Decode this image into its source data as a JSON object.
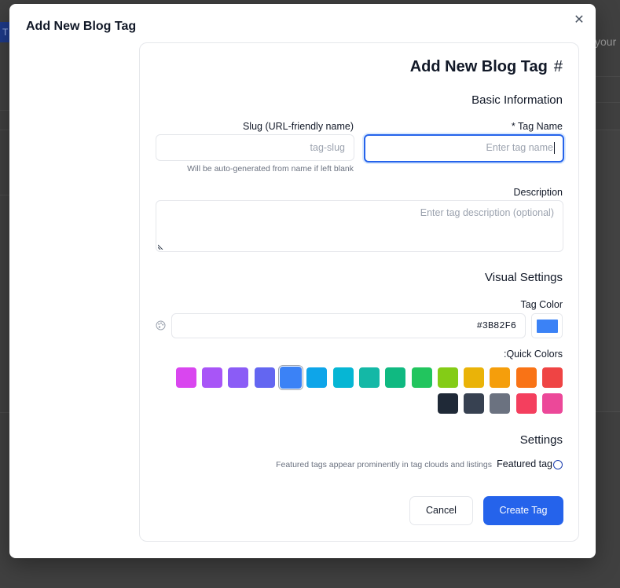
{
  "background": {
    "left_strip_text": "T",
    "right_text": "your"
  },
  "modal": {
    "title": "Add New Blog Tag",
    "close_icon": "close-icon"
  },
  "form": {
    "heading": "Add New Blog Tag",
    "heading_icon": "#",
    "basic_section": "Basic Information",
    "tag_name": {
      "label": "* Tag Name",
      "placeholder": "Enter tag name",
      "value": ""
    },
    "slug": {
      "label": "Slug (URL-friendly name)",
      "placeholder": "tag-slug",
      "help": "Will be auto-generated from name if left blank",
      "value": ""
    },
    "description": {
      "label": "Description",
      "placeholder": "Enter tag description (optional)",
      "value": ""
    },
    "visual_section": "Visual Settings",
    "tag_color": {
      "label": "Tag Color",
      "value": "#3B82F6",
      "palette_icon": "palette-icon"
    },
    "quick_colors_label": ":Quick Colors",
    "quick_colors_row1": [
      "#ef4444",
      "#f97316",
      "#f59e0b",
      "#eab308",
      "#84cc16",
      "#22c55e",
      "#10b981",
      "#14b8a6",
      "#06b6d4",
      "#0ea5e9",
      "#3b82f6",
      "#6366f1",
      "#8b5cf6",
      "#a855f7",
      "#d946ef"
    ],
    "quick_colors_row2": [
      "#ec4899",
      "#f43f5e",
      "#6b7280",
      "#374151",
      "#1f2937"
    ],
    "selected_color": "#3b82f6",
    "settings_section": "Settings",
    "featured": {
      "label": "Featured tag",
      "help": "Featured tags appear prominently in tag clouds and listings",
      "checked": false
    },
    "buttons": {
      "cancel": "Cancel",
      "create": "Create Tag"
    }
  }
}
